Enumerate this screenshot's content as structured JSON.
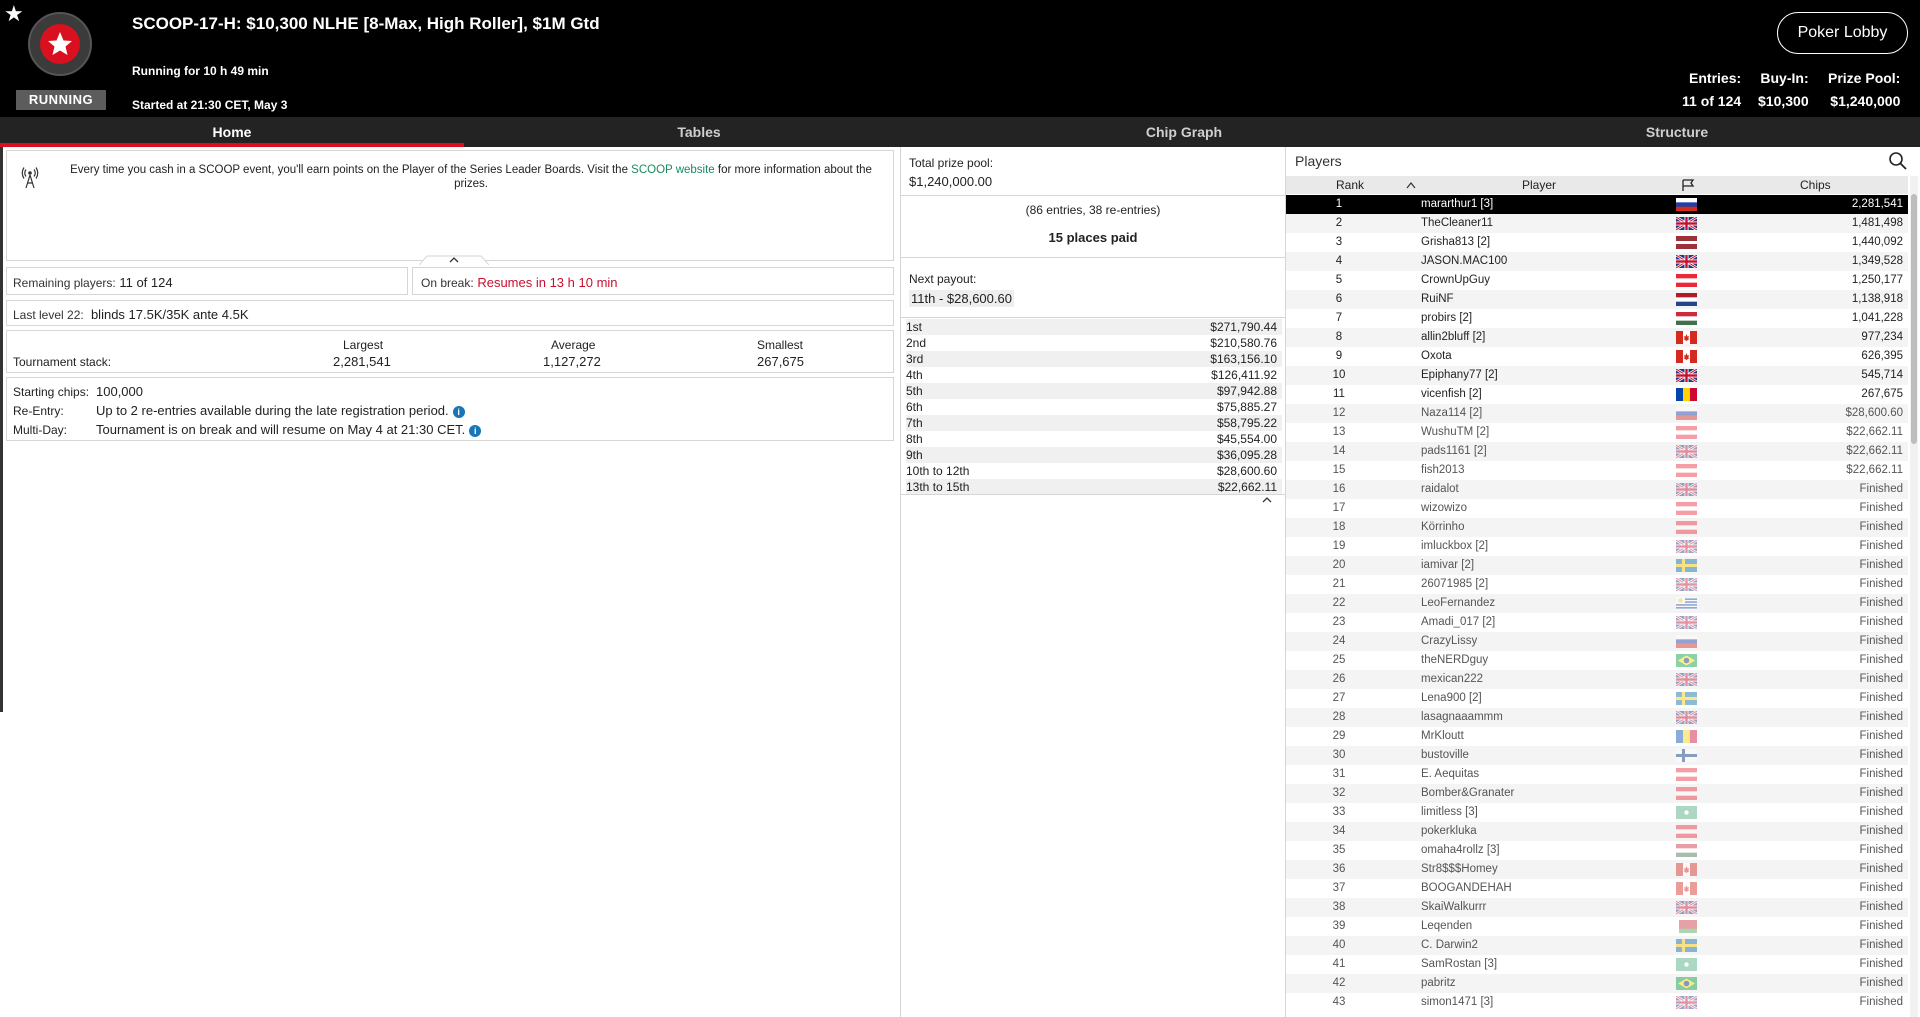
{
  "header": {
    "title": "SCOOP-17-H: $10,300 NLHE [8-Max, High Roller], $1M Gtd",
    "status_badge": "RUNNING",
    "running_for": "Running for 10 h 49 min",
    "started_at": "Started at 21:30 CET, May 3",
    "lobby_button": "Poker Lobby",
    "entries_label": "Entries:",
    "entries_value": "11 of 124",
    "buyin_label": "Buy-In:",
    "buyin_value": "$10,300",
    "prizepool_label": "Prize Pool:",
    "prizepool_value": "$1,240,000",
    "icons": [
      "star-icon",
      "pokerstars-logo-icon"
    ]
  },
  "tabs": [
    {
      "label": "Home",
      "active": true
    },
    {
      "label": "Tables",
      "active": false
    },
    {
      "label": "Chip Graph",
      "active": false
    },
    {
      "label": "Structure",
      "active": false
    }
  ],
  "home": {
    "info_pre": "Every time you cash in a SCOOP event, you'll earn points on the Player of the Series Leader Boards. Visit the ",
    "info_link": "SCOOP website",
    "info_post": " for more information about the prizes.",
    "remaining_label": "Remaining players:",
    "remaining_value": "11 of 124",
    "break_label": "On break:",
    "break_value": "Resumes in 13 h 10 min",
    "last_level_label": "Last level 22:",
    "last_level_value": "blinds 17.5K/35K ante 4.5K",
    "stack_label": "Tournament stack:",
    "largest_label": "Largest",
    "largest_value": "2,281,541",
    "average_label": "Average",
    "average_value": "1,127,272",
    "smallest_label": "Smallest",
    "smallest_value": "267,675",
    "starting_chips_label": "Starting chips:",
    "starting_chips_value": "100,000",
    "reentry_label": "Re-Entry:",
    "reentry_value": "Up to 2 re-entries available during the late registration period.",
    "multiday_label": "Multi-Day:",
    "multiday_value": "Tournament is on break and will resume on May 4 at 21:30 CET.",
    "info_icon_glyph": "i"
  },
  "payouts": {
    "total_label": "Total prize pool:",
    "total_value": "$1,240,000.00",
    "entries_note": "(86 entries, 38 re-entries)",
    "places_paid": "15 places paid",
    "next_label": "Next payout:",
    "next_value": "11th - $28,600.60",
    "rows": [
      {
        "place": "1st",
        "amount": "$271,790.44"
      },
      {
        "place": "2nd",
        "amount": "$210,580.76"
      },
      {
        "place": "3rd",
        "amount": "$163,156.10"
      },
      {
        "place": "4th",
        "amount": "$126,411.92"
      },
      {
        "place": "5th",
        "amount": "$97,942.88"
      },
      {
        "place": "6th",
        "amount": "$75,885.27"
      },
      {
        "place": "7th",
        "amount": "$58,795.22"
      },
      {
        "place": "8th",
        "amount": "$45,554.00"
      },
      {
        "place": "9th",
        "amount": "$36,095.28"
      },
      {
        "place": "10th to 12th",
        "amount": "$28,600.60"
      },
      {
        "place": "13th to 15th",
        "amount": "$22,662.11"
      }
    ]
  },
  "players": {
    "title": "Players",
    "col_rank": "Rank",
    "col_player": "Player",
    "col_chips": "Chips",
    "rows": [
      {
        "rank": "1",
        "name": "mararthur1 [3]",
        "chips": "2,281,541",
        "flag": "ru",
        "state": "selected"
      },
      {
        "rank": "2",
        "name": "TheCleaner11",
        "chips": "1,481,498",
        "flag": "gb",
        "state": "active"
      },
      {
        "rank": "3",
        "name": "Grisha813 [2]",
        "chips": "1,440,092",
        "flag": "lv",
        "state": "active"
      },
      {
        "rank": "4",
        "name": "JASON.MAC100",
        "chips": "1,349,528",
        "flag": "gb",
        "state": "active"
      },
      {
        "rank": "5",
        "name": "CrownUpGuy",
        "chips": "1,250,177",
        "flag": "at",
        "state": "active"
      },
      {
        "rank": "6",
        "name": "RuiNF",
        "chips": "1,138,918",
        "flag": "nl",
        "state": "active"
      },
      {
        "rank": "7",
        "name": "probirs [2]",
        "chips": "1,041,228",
        "flag": "hu",
        "state": "active"
      },
      {
        "rank": "8",
        "name": "allin2bluff [2]",
        "chips": "977,234",
        "flag": "ca",
        "state": "active"
      },
      {
        "rank": "9",
        "name": "Oxota",
        "chips": "626,395",
        "flag": "ca",
        "state": "active"
      },
      {
        "rank": "10",
        "name": "Epiphany77 [2]",
        "chips": "545,714",
        "flag": "gb",
        "state": "active"
      },
      {
        "rank": "11",
        "name": "vicenfish [2]",
        "chips": "267,675",
        "flag": "md",
        "state": "active"
      },
      {
        "rank": "12",
        "name": "Naza114 [2]",
        "chips": "$28,600.60",
        "flag": "ru",
        "state": "cashed"
      },
      {
        "rank": "13",
        "name": "WushuTM [2]",
        "chips": "$22,662.11",
        "flag": "at",
        "state": "cashed"
      },
      {
        "rank": "14",
        "name": "pads1161 [2]",
        "chips": "$22,662.11",
        "flag": "gb",
        "state": "cashed"
      },
      {
        "rank": "15",
        "name": "fish2013",
        "chips": "$22,662.11",
        "flag": "at",
        "state": "cashed"
      },
      {
        "rank": "16",
        "name": "raidalot",
        "chips": "Finished",
        "flag": "gb",
        "state": "finished"
      },
      {
        "rank": "17",
        "name": "wizowizo",
        "chips": "Finished",
        "flag": "at",
        "state": "finished"
      },
      {
        "rank": "18",
        "name": "Körrinho",
        "chips": "Finished",
        "flag": "at",
        "state": "finished"
      },
      {
        "rank": "19",
        "name": "imluckbox [2]",
        "chips": "Finished",
        "flag": "gb",
        "state": "finished"
      },
      {
        "rank": "20",
        "name": "iamivar [2]",
        "chips": "Finished",
        "flag": "se",
        "state": "finished"
      },
      {
        "rank": "21",
        "name": "26071985 [2]",
        "chips": "Finished",
        "flag": "gb",
        "state": "finished"
      },
      {
        "rank": "22",
        "name": "LeoFernandez",
        "chips": "Finished",
        "flag": "uy",
        "state": "finished"
      },
      {
        "rank": "23",
        "name": "Amadi_017 [2]",
        "chips": "Finished",
        "flag": "gb",
        "state": "finished"
      },
      {
        "rank": "24",
        "name": "CrazyLissy",
        "chips": "Finished",
        "flag": "ru",
        "state": "finished"
      },
      {
        "rank": "25",
        "name": "theNERDguy",
        "chips": "Finished",
        "flag": "br",
        "state": "finished"
      },
      {
        "rank": "26",
        "name": "mexican222",
        "chips": "Finished",
        "flag": "gb",
        "state": "finished"
      },
      {
        "rank": "27",
        "name": "Lena900 [2]",
        "chips": "Finished",
        "flag": "se",
        "state": "finished"
      },
      {
        "rank": "28",
        "name": "lasagnaaammm",
        "chips": "Finished",
        "flag": "gb",
        "state": "finished"
      },
      {
        "rank": "29",
        "name": "MrKloutt",
        "chips": "Finished",
        "flag": "md",
        "state": "finished"
      },
      {
        "rank": "30",
        "name": "bustoville",
        "chips": "Finished",
        "flag": "fi",
        "state": "finished"
      },
      {
        "rank": "31",
        "name": "E. Aequitas",
        "chips": "Finished",
        "flag": "at",
        "state": "finished"
      },
      {
        "rank": "32",
        "name": "Bomber&Granater",
        "chips": "Finished",
        "flag": "at",
        "state": "finished"
      },
      {
        "rank": "33",
        "name": "limitless [3]",
        "chips": "Finished",
        "flag": "mk",
        "state": "finished"
      },
      {
        "rank": "34",
        "name": "pokerkluka",
        "chips": "Finished",
        "flag": "at",
        "state": "finished"
      },
      {
        "rank": "35",
        "name": "omaha4rollz [3]",
        "chips": "Finished",
        "flag": "hu",
        "state": "finished"
      },
      {
        "rank": "36",
        "name": "Str8$$$Homey",
        "chips": "Finished",
        "flag": "ca",
        "state": "finished"
      },
      {
        "rank": "37",
        "name": "BOOGANDEHAH",
        "chips": "Finished",
        "flag": "ca",
        "state": "finished"
      },
      {
        "rank": "38",
        "name": "SkaiWalkurrr",
        "chips": "Finished",
        "flag": "gb",
        "state": "finished"
      },
      {
        "rank": "39",
        "name": "Leqenden",
        "chips": "Finished",
        "flag": "by",
        "state": "finished"
      },
      {
        "rank": "40",
        "name": "C. Darwin2",
        "chips": "Finished",
        "flag": "se",
        "state": "finished"
      },
      {
        "rank": "41",
        "name": "SamRostan [3]",
        "chips": "Finished",
        "flag": "mk",
        "state": "finished"
      },
      {
        "rank": "42",
        "name": "pabritz",
        "chips": "Finished",
        "flag": "br",
        "state": "finished"
      },
      {
        "rank": "43",
        "name": "simon1471 [3]",
        "chips": "Finished",
        "flag": "gb",
        "state": "finished"
      }
    ]
  }
}
